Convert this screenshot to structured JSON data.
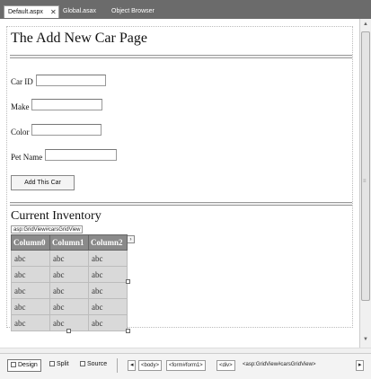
{
  "tabs": [
    {
      "label": "Default.aspx",
      "active": true
    },
    {
      "label": "Global.asax",
      "active": false
    },
    {
      "label": "Object Browser",
      "active": false
    }
  ],
  "designer": {
    "page_title": "The Add New Car Page",
    "fields": [
      {
        "label": "Car ID",
        "value": ""
      },
      {
        "label": "Make",
        "value": ""
      },
      {
        "label": "Color",
        "value": ""
      },
      {
        "label": "Pet Name",
        "value": ""
      }
    ],
    "add_button_label": "Add This Car",
    "inventory_title": "Current Inventory",
    "grid_tag": "asp:GridView#carsGridView",
    "grid": {
      "columns": [
        "Column0",
        "Column1",
        "Column2"
      ],
      "rows": [
        [
          "abc",
          "abc",
          "abc"
        ],
        [
          "abc",
          "abc",
          "abc"
        ],
        [
          "abc",
          "abc",
          "abc"
        ],
        [
          "abc",
          "abc",
          "abc"
        ],
        [
          "abc",
          "abc",
          "abc"
        ]
      ]
    }
  },
  "status_bar": {
    "view_buttons": [
      {
        "label": "Design",
        "active": true
      },
      {
        "label": "Split",
        "active": false
      },
      {
        "label": "Source",
        "active": false
      }
    ],
    "breadcrumbs": [
      "<body>",
      "<form#form1>",
      "<div>",
      "<asp:GridView#carsGridView>"
    ]
  }
}
